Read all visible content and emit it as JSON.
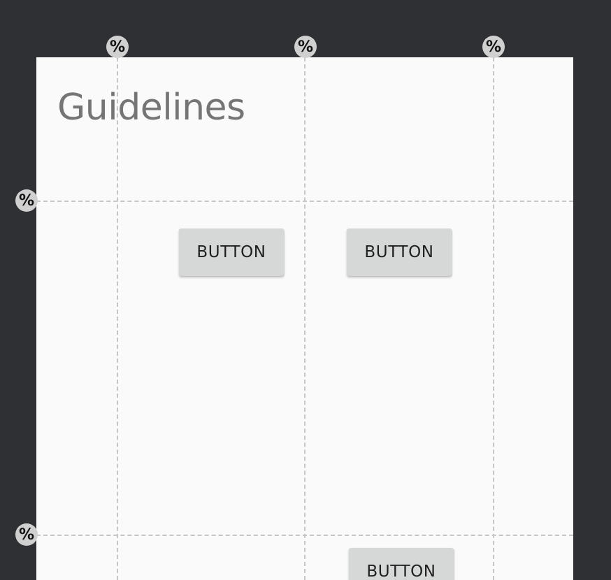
{
  "screen": {
    "title": "Guidelines"
  },
  "guideline_handles": {
    "symbol": "%",
    "icon": "percent-icon"
  },
  "buttons": {
    "button_1": "BUTTON",
    "button_2": "BUTTON",
    "button_3": "BUTTON"
  },
  "colors": {
    "editor_background": "#2f3033",
    "device_background": "#fafafa",
    "guideline": "#c7c7c7",
    "handle": "#d0d0d0",
    "button": "#d6d7d7",
    "title_text": "#757575",
    "button_text": "#1f1f1f"
  }
}
